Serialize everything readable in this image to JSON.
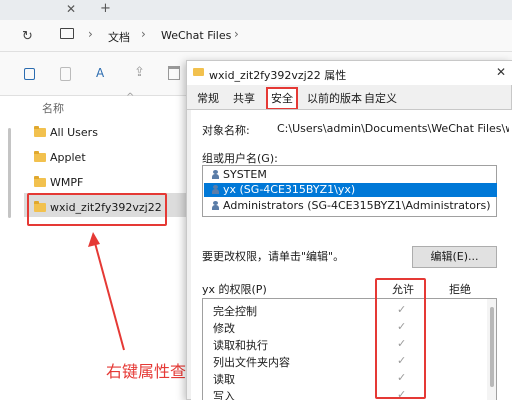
{
  "explorer": {
    "breadcrumb": [
      "文档",
      "WeChat Files"
    ],
    "nav_header": "名称",
    "folders": [
      "All Users",
      "Applet",
      "WMPF",
      "wxid_zit2fy392vzj22"
    ],
    "annotation": "右键属性查看"
  },
  "dialog": {
    "title": "wxid_zit2fy392vzj22 属性",
    "tabs": [
      "常规",
      "共享",
      "安全",
      "以前的版本",
      "自定义"
    ],
    "active_tab": "安全",
    "object_label": "对象名称:",
    "object_value": "C:\\Users\\admin\\Documents\\WeChat Files\\wxid_zit",
    "groups_label": "组或用户名(G):",
    "groups": [
      "SYSTEM",
      "yx (SG-4CE315BYZ1\\yx)",
      "Administrators (SG-4CE315BYZ1\\Administrators)"
    ],
    "selected_group_index": 1,
    "change_hint": "要更改权限，请单击\"编辑\"。",
    "edit_button": "编辑(E)...",
    "perm_label": "yx 的权限(P)",
    "allow_header": "允许",
    "deny_header": "拒绝",
    "permissions": [
      "完全控制",
      "修改",
      "读取和执行",
      "列出文件夹内容",
      "读取",
      "写入"
    ],
    "check_glyph": "✓"
  },
  "colors": {
    "accent": "#0078d7",
    "annotation_red": "#e53935"
  }
}
